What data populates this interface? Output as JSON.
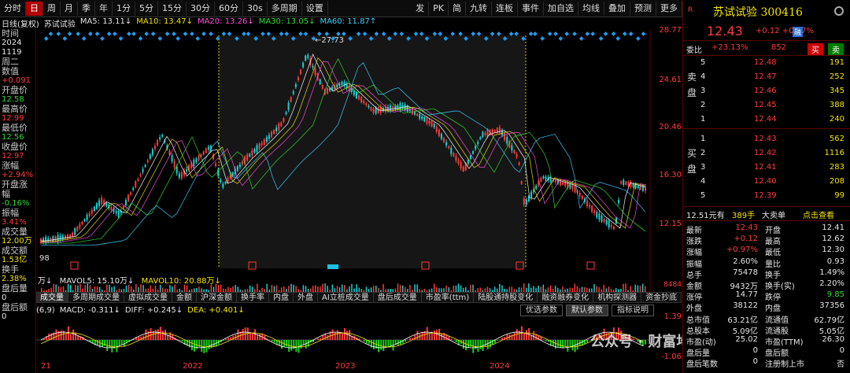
{
  "toolbar": {
    "left": [
      "分时",
      "日",
      "周",
      "月",
      "季",
      "年",
      "1分",
      "5分",
      "15分",
      "30分",
      "60分",
      "30s",
      "多周期",
      "设置"
    ],
    "active": "日",
    "right": [
      "发",
      "PK",
      "简",
      "九转",
      "连板",
      "事件",
      "加自选",
      "均线",
      "叠加",
      "预测",
      "更多"
    ]
  },
  "infobar": {
    "title": "日线(复权)",
    "name": "苏试试验",
    "ma5": "MA5: 13.11↓",
    "ma10": "MA10: 13.47↓",
    "ma20": "MA20: 13.26↓",
    "ma30": "MA30: 13.05↓",
    "ma60": "MA60: 11.87↑"
  },
  "left": {
    "time_label": "时间",
    "year": "2024",
    "date": "1119",
    "weekday": "周二",
    "value_label": "数值",
    "value": "+0.091",
    "open_label": "开盘价",
    "open": "12.58",
    "high_label": "最高价",
    "high": "12.99",
    "low_label": "最低价",
    "low": "12.56",
    "close_label": "收盘价",
    "close": "12.97",
    "chg_label": "涨幅",
    "chg": "+2.94%",
    "open_chg_label": "开盘涨幅",
    "open_chg": "-0.16%",
    "amp_label": "振幅",
    "amp": "3.41%",
    "vol_label": "成交量",
    "vol": "12.00万",
    "amt_label": "成交额",
    "amt": "1.53亿",
    "turn_label": "换手",
    "turn": "2.38%",
    "after_label": "盘后量",
    "after": "0",
    "after_amt_label": "盘后额",
    "after_amt": "0"
  },
  "scales": [
    "28.77",
    "24.61",
    "20.46",
    "16.30",
    "12.15"
  ],
  "annot": {
    "peak": "27.73",
    "low": "98",
    "vol_r": "8484"
  },
  "vol_line": {
    "unit": "万↓",
    "mavol5": "MAVOL5: 15.10万↓",
    "mavol10": "MAVOL10: 20.88万↓"
  },
  "tabs": [
    "成交量",
    "多周期成交量",
    "虚拟成交量",
    "金额",
    "沪深金额",
    "换手率",
    "内盘",
    "外盘",
    "AI立桩成交量",
    "盘后成交量",
    "市盈率(ttm)",
    "陆股通持股变化",
    "融资融券变化",
    "机构探测器",
    "资金抄底"
  ],
  "macd": {
    "params": "(6,9)",
    "macd": "MACD: -0.311↓",
    "diff": "DIFF: +0.245↓",
    "dea": "DEA: +0.401↓",
    "btn1": "优选参数",
    "btn2": "默认参数",
    "btn3": "指标说明",
    "top": "1.39",
    "bottom": "-1.06"
  },
  "xaxis": [
    "21",
    "2022",
    "2023",
    "2024"
  ],
  "right": {
    "mark": "R",
    "name": "苏试试验",
    "code": "300416",
    "price": "12.43",
    "chg": "+0.12",
    "chg_pct": "+0.97%",
    "badge": "融",
    "wb_label": "委比",
    "wb": "+23.13%",
    "wc": "852",
    "buy_btn": "买",
    "sell_btn": "卖",
    "sell_side": "卖盘",
    "buy_side": "买盘",
    "asks": [
      {
        "lv": "5",
        "price": "12.48",
        "vol": "191"
      },
      {
        "lv": "4",
        "price": "12.47",
        "vol": "252"
      },
      {
        "lv": "3",
        "price": "12.46",
        "vol": "345"
      },
      {
        "lv": "2",
        "price": "12.45",
        "vol": "388"
      },
      {
        "lv": "1",
        "price": "12.44",
        "vol": "240"
      }
    ],
    "bids": [
      {
        "lv": "1",
        "price": "12.43",
        "vol": "562"
      },
      {
        "lv": "2",
        "price": "12.42",
        "vol": "1116"
      },
      {
        "lv": "3",
        "price": "12.41",
        "vol": "283"
      },
      {
        "lv": "4",
        "price": "12.40",
        "vol": "208"
      },
      {
        "lv": "5",
        "price": "12.39",
        "vol": "99"
      }
    ],
    "deal_price": "12.51元有",
    "deal_vol": "389手",
    "deal_type": "大卖单",
    "deal_link": "点击查看",
    "stats": [
      [
        "最新",
        "12.43",
        "开盘",
        "12.41"
      ],
      [
        "涨跌",
        "+0.12",
        "最高",
        "12.62"
      ],
      [
        "涨幅",
        "+0.97%",
        "最低",
        "12.30"
      ],
      [
        "振幅",
        "2.60%",
        "量比",
        "0.93"
      ],
      [
        "总手",
        "75478",
        "换手",
        "1.49%"
      ],
      [
        "金额",
        "9432万",
        "换手(实)",
        "2.20%"
      ],
      [
        "涨停",
        "14.77",
        "跌停",
        "9.85"
      ],
      [
        "外盘",
        "38122",
        "内盘",
        "37356"
      ],
      [
        "总市值",
        "63.21亿",
        "流通值",
        "62.79亿"
      ],
      [
        "总股本",
        "5.09亿",
        "流通股",
        "5.05亿"
      ],
      [
        "市盈(动)",
        "25.02",
        "市盈(TTM)",
        "26.30"
      ],
      [
        "盘后量",
        "0",
        "盘后额",
        "0"
      ],
      [
        "盘后笔数",
        "0",
        "注册制上市",
        "否"
      ]
    ]
  },
  "watermark": "公众号 · 财富地图"
}
